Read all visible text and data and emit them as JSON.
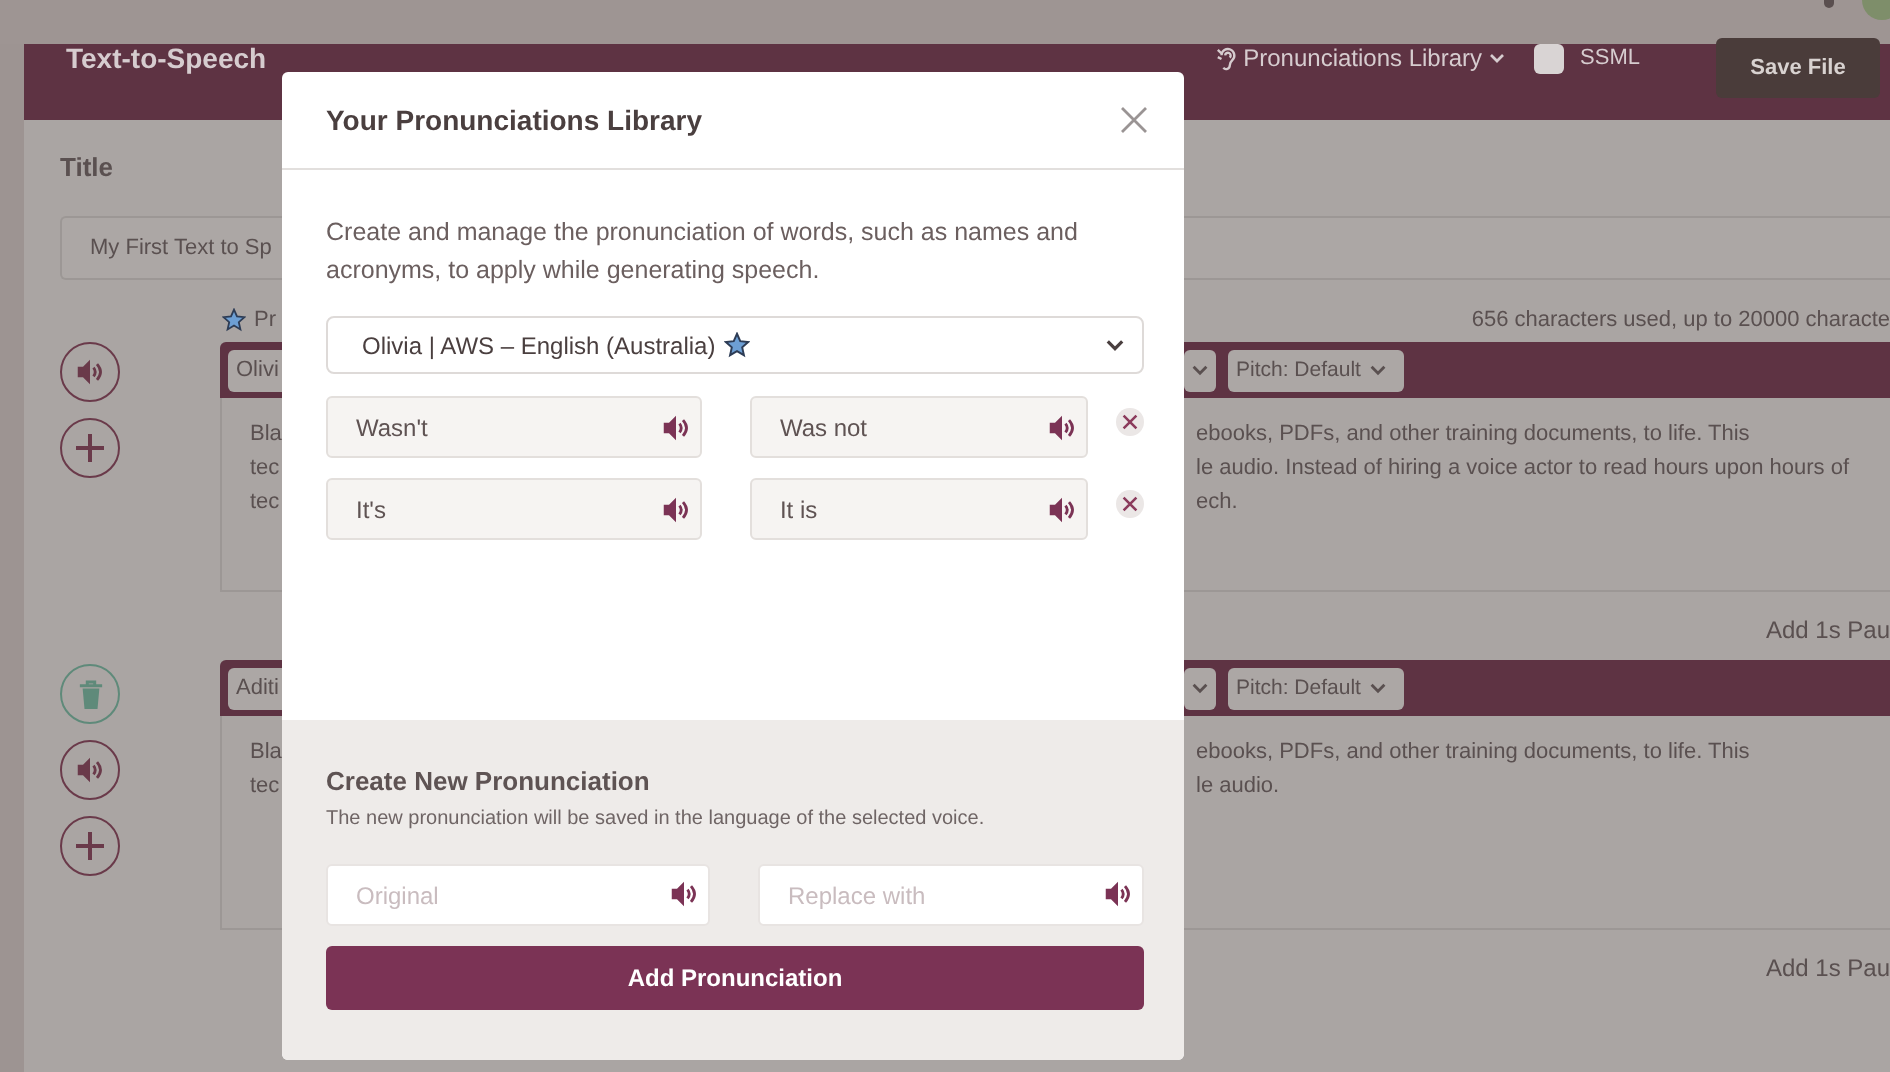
{
  "app": {
    "title": "Text-to-Speech",
    "library_menu": "Pronunciations Library",
    "ssml": {
      "label": "SSML",
      "checked": false
    },
    "save_button": "Save File"
  },
  "title_label": "Title",
  "title_input": "My First Text to Sp",
  "voice_hint": "Pr",
  "usage": "656 characters used, up to 20000 characte",
  "blocks": [
    {
      "deletable": false,
      "voice": "Olivi",
      "pitch": "Pitch: Default",
      "lines_left": [
        "Bla",
        "tec",
        "tec"
      ],
      "lines_right": [
        "ebooks, PDFs, and other training documents, to life. This",
        "le audio. Instead of hiring a voice actor to read hours upon hours of",
        "ech."
      ],
      "pause": "Add 1s Pau"
    },
    {
      "deletable": true,
      "voice": "Aditi",
      "pitch": "Pitch: Default",
      "lines_left": [
        "Bla",
        "tec"
      ],
      "lines_right": [
        "ebooks, PDFs, and other training documents, to life. This",
        "le audio."
      ],
      "pause": "Add 1s Pau"
    }
  ],
  "dialog": {
    "title": "Your Pronunciations Library",
    "description": "Create and manage the pronunciation of words, such as names and acronyms, to apply while generating speech.",
    "voice_select": "Olivia | AWS – English (Australia)",
    "entries": [
      {
        "original": "Wasn't",
        "replacement": "Was not"
      },
      {
        "original": "It's",
        "replacement": "It is"
      }
    ],
    "create": {
      "heading": "Create New Pronunciation",
      "note": "The new pronunciation will be saved in the language of the selected voice.",
      "original_placeholder": "Original",
      "replace_placeholder": "Replace with",
      "button": "Add Pronunciation"
    }
  }
}
